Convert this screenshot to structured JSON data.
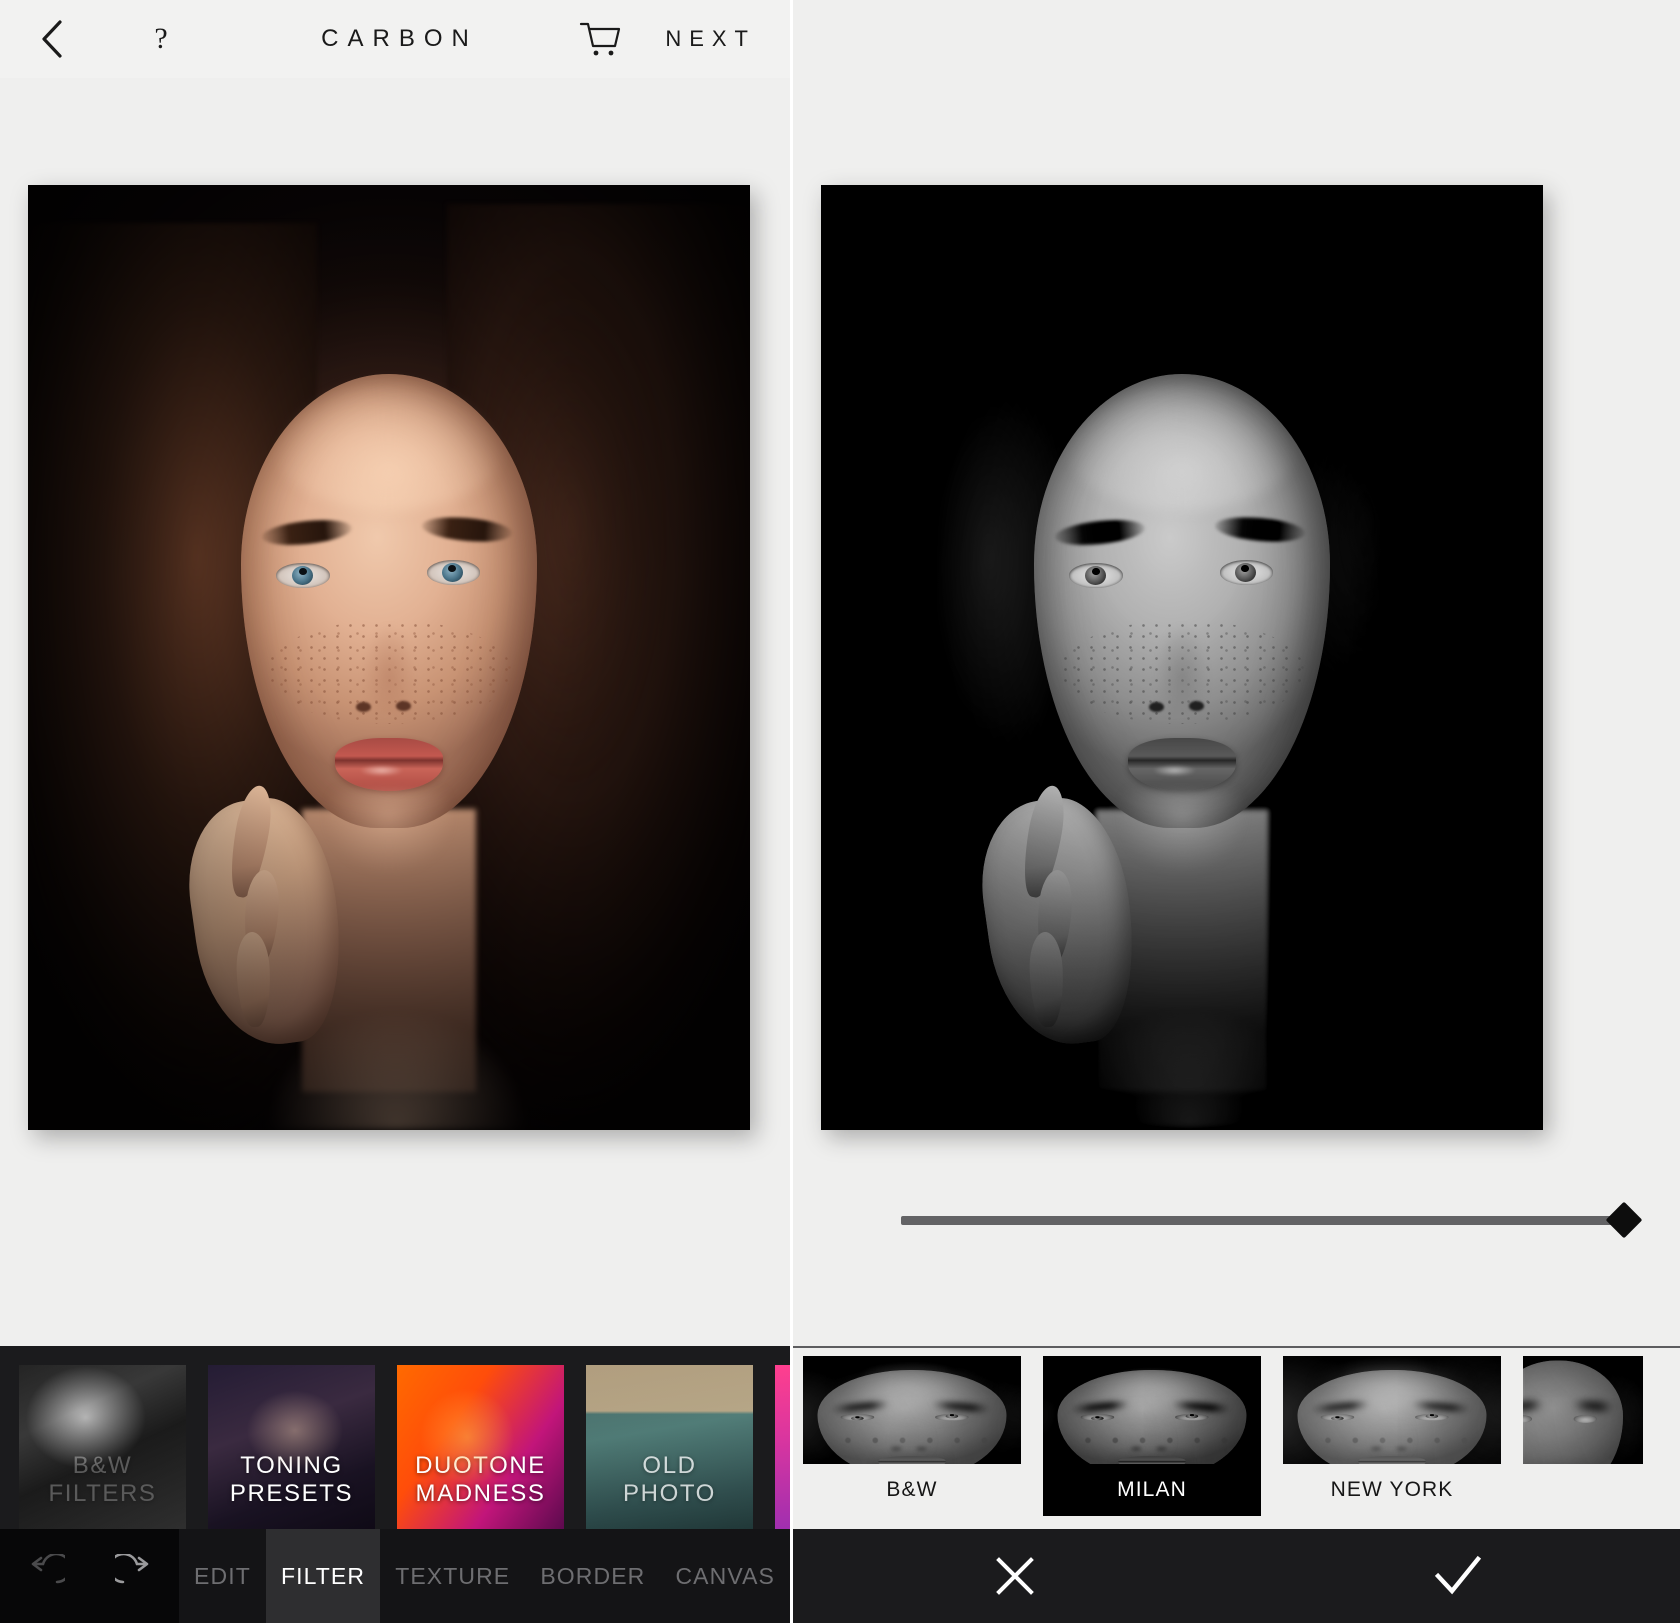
{
  "app": {
    "name": "CARBON",
    "accent_dark": "#141416",
    "accent_panel": "#efefee",
    "selected_bg": "#000000"
  },
  "left": {
    "header": {
      "back_icon": "chevron-left-icon",
      "help_label": "?",
      "title": "CARBON",
      "cart_icon": "shopping-cart-icon",
      "next_label": "NEXT"
    },
    "photo": {
      "alt": "color portrait of freckled woman with hand at chin",
      "mode": "original"
    },
    "filter_packs": [
      {
        "line1": "B&W",
        "line2": "FILTERS",
        "theme": "bw"
      },
      {
        "line1": "TONING",
        "line2": "PRESETS",
        "theme": "toning"
      },
      {
        "line1": "DUOTONE",
        "line2": "MADNESS",
        "theme": "duotone"
      },
      {
        "line1": "OLD",
        "line2": "PHOTO",
        "theme": "oldphoto"
      },
      {
        "line1": "",
        "line2": "",
        "theme": "pink"
      }
    ],
    "toolbar": {
      "undo_icon": "undo-icon",
      "redo_icon": "redo-icon",
      "tabs": [
        {
          "label": "EDIT",
          "active": false
        },
        {
          "label": "FILTER",
          "active": true
        },
        {
          "label": "TEXTURE",
          "active": false
        },
        {
          "label": "BORDER",
          "active": false
        },
        {
          "label": "CANVAS",
          "active": false
        }
      ]
    }
  },
  "right": {
    "photo": {
      "alt": "black and white portrait of freckled woman with hand at chin",
      "mode": "milan-filter"
    },
    "slider": {
      "name": "filter-intensity",
      "value": 100,
      "min": 0,
      "max": 100,
      "handle_icon": "diamond-handle-icon"
    },
    "filters": [
      {
        "label": "B&W",
        "selected": false
      },
      {
        "label": "MILAN",
        "selected": true
      },
      {
        "label": "NEW YORK",
        "selected": false
      },
      {
        "label": "",
        "selected": false
      }
    ],
    "confirm_bar": {
      "cancel_icon": "close-icon",
      "apply_icon": "check-icon"
    }
  }
}
